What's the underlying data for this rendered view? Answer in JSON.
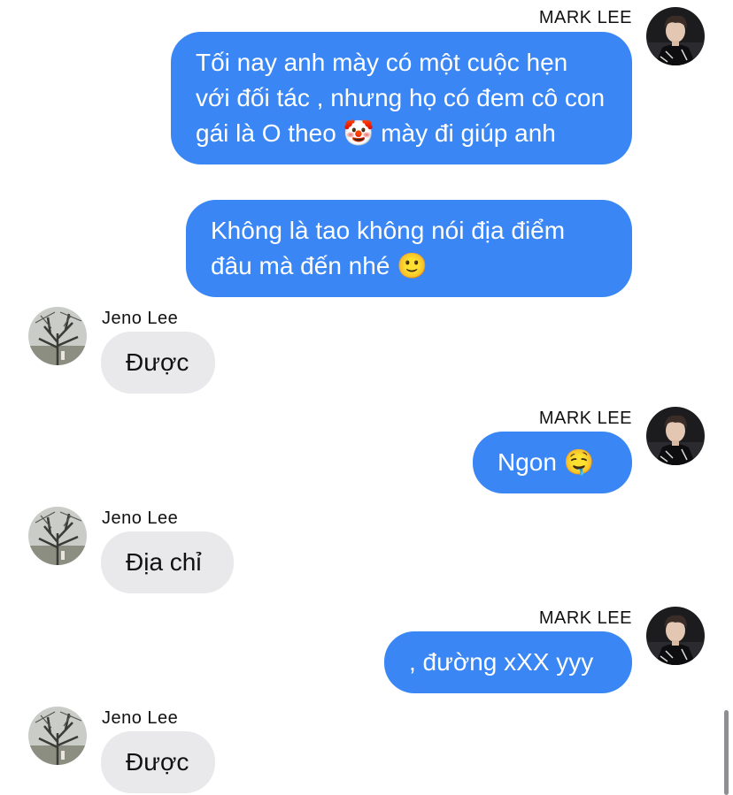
{
  "participants": {
    "mark": {
      "name": "MARK LEE"
    },
    "jeno": {
      "name": "Jeno Lee"
    }
  },
  "messages": [
    {
      "sender": "MARK LEE",
      "text": "Tối nay anh mày có một cuộc hẹn với đối tác , nhưng họ có đem cô con gái là O theo 🤡 mày đi giúp anh"
    },
    {
      "sender": "MARK LEE",
      "text": "Không là tao không nói địa điểm đâu mà đến nhé 🙂"
    },
    {
      "sender": "Jeno Lee",
      "text": "Được"
    },
    {
      "sender": "MARK LEE",
      "text": "Ngon 🤤"
    },
    {
      "sender": "Jeno Lee",
      "text": "Địa chỉ"
    },
    {
      "sender": "MARK LEE",
      "text": ", đường xXX yyy"
    },
    {
      "sender": "Jeno Lee",
      "text": "Được"
    }
  ],
  "colors": {
    "outgoing_bubble": "#3a86f5",
    "incoming_bubble": "#e9e9ec",
    "outgoing_text": "#ffffff",
    "incoming_text": "#111111"
  }
}
